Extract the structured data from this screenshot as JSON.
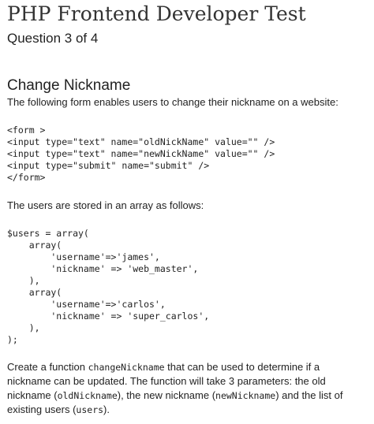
{
  "test": {
    "title": "PHP Frontend Developer Test",
    "progress": "Question 3 of 4"
  },
  "question": {
    "title": "Change Nickname",
    "intro": "The following form enables users to change their nickname on a website:",
    "form_code": [
      "<form >",
      "<input type=\"text\" name=\"oldNickName\" value=\"\" />",
      "<input type=\"text\" name=\"newNickName\" value=\"\" />",
      "<input type=\"submit\" name=\"submit\" />",
      "</form>"
    ],
    "users_intro": "The users are stored in an array as follows:",
    "users_code": [
      "$users = array(",
      "    array(",
      "        'username'=>'james',",
      "        'nickname' => 'web_master',",
      "    ),",
      "    array(",
      "        'username'=>'carlos',",
      "        'nickname' => 'super_carlos',",
      "    ),",
      ");"
    ],
    "task": {
      "text_1": "Create a function ",
      "code_1": "changeNickname",
      "text_2": " that can be used to determine if a nickname can be updated. The function will take 3 parameters: the old nickname (",
      "code_2": "oldNickname",
      "text_3": "), the new nickname (",
      "code_3": "newNickname",
      "text_4": ") and the list of existing users (",
      "code_4": "users",
      "text_5": ")."
    }
  }
}
